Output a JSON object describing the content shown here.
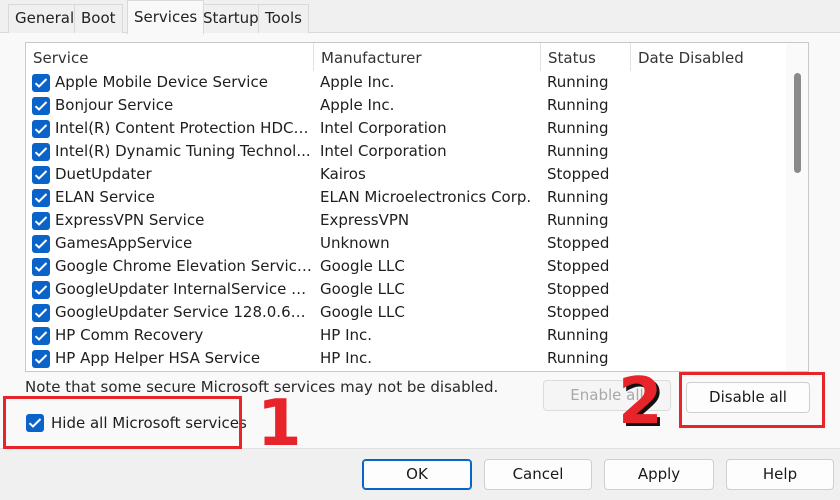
{
  "tabs": [
    {
      "label": "General"
    },
    {
      "label": "Boot"
    },
    {
      "label": "Services"
    },
    {
      "label": "Startup"
    },
    {
      "label": "Tools"
    }
  ],
  "table": {
    "columns": [
      "Service",
      "Manufacturer",
      "Status",
      "Date Disabled"
    ],
    "rows": [
      {
        "service": "Apple Mobile Device Service",
        "manufacturer": "Apple Inc.",
        "status": "Running",
        "date": ""
      },
      {
        "service": "Bonjour Service",
        "manufacturer": "Apple Inc.",
        "status": "Running",
        "date": ""
      },
      {
        "service": "Intel(R) Content Protection HDCP ...",
        "manufacturer": "Intel Corporation",
        "status": "Running",
        "date": ""
      },
      {
        "service": "Intel(R) Dynamic Tuning Technol...",
        "manufacturer": "Intel Corporation",
        "status": "Running",
        "date": ""
      },
      {
        "service": "DuetUpdater",
        "manufacturer": "Kairos",
        "status": "Stopped",
        "date": ""
      },
      {
        "service": "ELAN Service",
        "manufacturer": "ELAN Microelectronics Corp.",
        "status": "Running",
        "date": ""
      },
      {
        "service": "ExpressVPN Service",
        "manufacturer": "ExpressVPN",
        "status": "Running",
        "date": ""
      },
      {
        "service": "GamesAppService",
        "manufacturer": "Unknown",
        "status": "Stopped",
        "date": ""
      },
      {
        "service": "Google Chrome Elevation Service ...",
        "manufacturer": "Google LLC",
        "status": "Stopped",
        "date": ""
      },
      {
        "service": "GoogleUpdater InternalService 12...",
        "manufacturer": "Google LLC",
        "status": "Stopped",
        "date": ""
      },
      {
        "service": "GoogleUpdater Service 128.0.653...",
        "manufacturer": "Google LLC",
        "status": "Stopped",
        "date": ""
      },
      {
        "service": "HP Comm Recovery",
        "manufacturer": "HP Inc.",
        "status": "Running",
        "date": ""
      },
      {
        "service": "HP App Helper HSA Service",
        "manufacturer": "HP Inc.",
        "status": "Running",
        "date": ""
      }
    ]
  },
  "note": "Note that some secure Microsoft services may not be disabled.",
  "hide_ms_label": "Hide all Microsoft services",
  "buttons": {
    "enable_all": "Enable all",
    "disable_all": "Disable all",
    "ok": "OK",
    "cancel": "Cancel",
    "apply": "Apply",
    "help": "Help"
  },
  "annotations": {
    "step1": "1",
    "step2": "2"
  },
  "colors": {
    "accent": "#0a63c9",
    "annotation": "#e8242b"
  }
}
